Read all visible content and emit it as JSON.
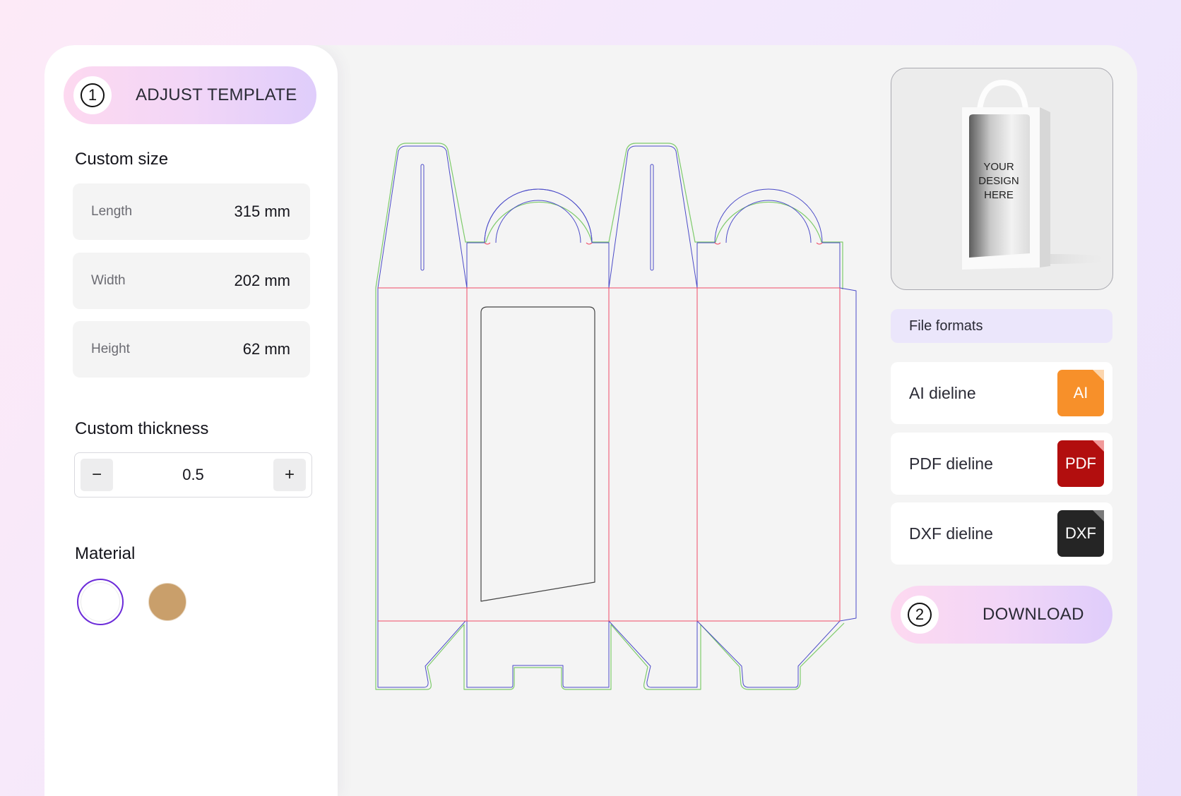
{
  "adjust": {
    "step": "1",
    "label": "ADJUST TEMPLATE"
  },
  "custom_size": {
    "title": "Custom size",
    "fields": [
      {
        "label": "Length",
        "value": "315 mm"
      },
      {
        "label": "Width",
        "value": "202 mm"
      },
      {
        "label": "Height",
        "value": "62 mm"
      }
    ]
  },
  "thickness": {
    "title": "Custom thickness",
    "value": "0.5",
    "minus": "−",
    "plus": "+"
  },
  "material": {
    "title": "Material",
    "options": [
      {
        "name": "white",
        "color": "#ffffff",
        "selected": true
      },
      {
        "name": "kraft",
        "color": "#c99f6b",
        "selected": false
      }
    ],
    "selected_ring": "#6c2bd9"
  },
  "preview": {
    "text_lines": [
      "YOUR",
      "DESIGN",
      "HERE"
    ]
  },
  "file_formats": {
    "title": "File formats",
    "items": [
      {
        "name": "AI dieline",
        "badge": "AI",
        "color": "#f7902a",
        "fold": "#fcd6ae"
      },
      {
        "name": "PDF dieline",
        "badge": "PDF",
        "color": "#b20e0e",
        "fold": "#f19a9a"
      },
      {
        "name": "DXF dieline",
        "badge": "DXF",
        "color": "#252525",
        "fold": "#7a7a7a"
      }
    ]
  },
  "download": {
    "step": "2",
    "label": "DOWNLOAD"
  },
  "colors": {
    "cut": "#4b4bc8",
    "fold": "#ef4a66",
    "bleed": "#7ecb6b",
    "window": "#444444"
  }
}
